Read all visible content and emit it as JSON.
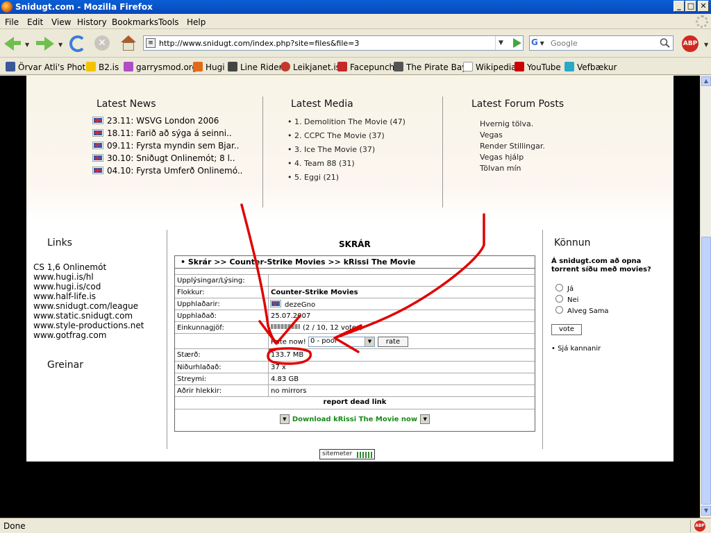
{
  "window": {
    "title": "Snidugt.com - Mozilla Firefox",
    "minimize": "_",
    "maximize": "□",
    "close": "✕"
  },
  "menu": [
    "File",
    "Edit",
    "View",
    "History",
    "Bookmarks",
    "Tools",
    "Help"
  ],
  "nav": {
    "url": "http://www.snidugt.com/index.php?site=files&file=3",
    "search_placeholder": "Google",
    "search_engine_icon": "G",
    "abp_label": "ABP"
  },
  "bookmarks": [
    {
      "label": "Örvar Atli's Photos",
      "color": "#3b5998"
    },
    {
      "label": "B2.is",
      "color": "#f3c300"
    },
    {
      "label": "garrysmod.org",
      "color": "#b04dc4"
    },
    {
      "label": "Hugi",
      "color": "#e06a1a"
    },
    {
      "label": "Line Rider",
      "color": "#444444"
    },
    {
      "label": "Leikjanet.is",
      "color": "#c0392b"
    },
    {
      "label": "Facepunch",
      "color": "#c62828"
    },
    {
      "label": "The Pirate Bay",
      "color": "#555555"
    },
    {
      "label": "Wikipedia",
      "color": "#ffffff"
    },
    {
      "label": "YouTube",
      "color": "#cc0000"
    },
    {
      "label": "Vefbækur",
      "color": "#2aa8c8"
    }
  ],
  "news": {
    "heading": "Latest News",
    "items": [
      "23.11: WSVG London 2006",
      "18.11: Farið að sýga á seinni..",
      "09.11: Fyrsta myndin sem Bjar..",
      "30.10: Sniðugt Onlinemót; 8 l..",
      "04.10: Fyrsta Umferð Onlinemó.."
    ]
  },
  "media": {
    "heading": "Latest Media",
    "items": [
      "1. Demolition The Movie (47)",
      "2. CCPC The Movie (37)",
      "3. Ice The Movie (37)",
      "4. Team 88 (31)",
      "5. Eggi (21)"
    ]
  },
  "forum": {
    "heading": "Latest Forum Posts",
    "items": [
      "Hvernig tölva.",
      "Vegas",
      "Render Stillingar.",
      "Vegas hjálp",
      "Tölvan mín"
    ]
  },
  "links": {
    "heading": "Links",
    "items": [
      "CS 1,6 Onlinemót",
      "www.hugi.is/hl",
      "www.hugi.is/cod",
      "www.half-life.is",
      "www.snidugt.com/league",
      "www.static.snidugt.com",
      "www.style-productions.net",
      "www.gotfrag.com"
    ],
    "categories_heading": "Greinar"
  },
  "file": {
    "section_title": "SKRÁR",
    "breadcrumb": "• Skrár >> Counter-Strike Movies >> kRissi The Movie",
    "rows": [
      {
        "label": "Upplýsingar/Lýsing:",
        "value": ""
      },
      {
        "label": "Flokkur:",
        "value": "Counter-Strike Movies"
      },
      {
        "label": "Upphlaðarir:",
        "value": "dezeGno"
      },
      {
        "label": "Upphlaðað:",
        "value": "25.07.2007"
      },
      {
        "label": "Einkunnagjöf:",
        "value": "(2 / 10, 12 votes)"
      },
      {
        "label": "",
        "value": "Rate now!"
      },
      {
        "label": "Stærð:",
        "value": "133.7 MB"
      },
      {
        "label": "Niðurhlaðað:",
        "value": "37 x"
      },
      {
        "label": "Streymi:",
        "value": "4.83 GB"
      },
      {
        "label": "Aðrir hlekkir:",
        "value": "no mirrors"
      }
    ],
    "rating": 2,
    "rating_max": 10,
    "rate_select_value": "0 - poor",
    "rate_button": "rate",
    "report_link": "report dead link",
    "download_link": "Download kRissi The Movie now"
  },
  "poll": {
    "heading": "Könnun",
    "question": "Á snidugt.com að opna torrent síðu með movies?",
    "options": [
      "Já",
      "Nei",
      "Alveg Sama"
    ],
    "vote_button": "vote",
    "results_link": "• Sjá kannanir"
  },
  "footer": {
    "sitemeter": "sitemeter"
  },
  "status": {
    "text": "Done"
  },
  "colors": {
    "titlebar": "#0a5fd6",
    "annotation": "#e00000",
    "download": "#1a8a1a"
  }
}
